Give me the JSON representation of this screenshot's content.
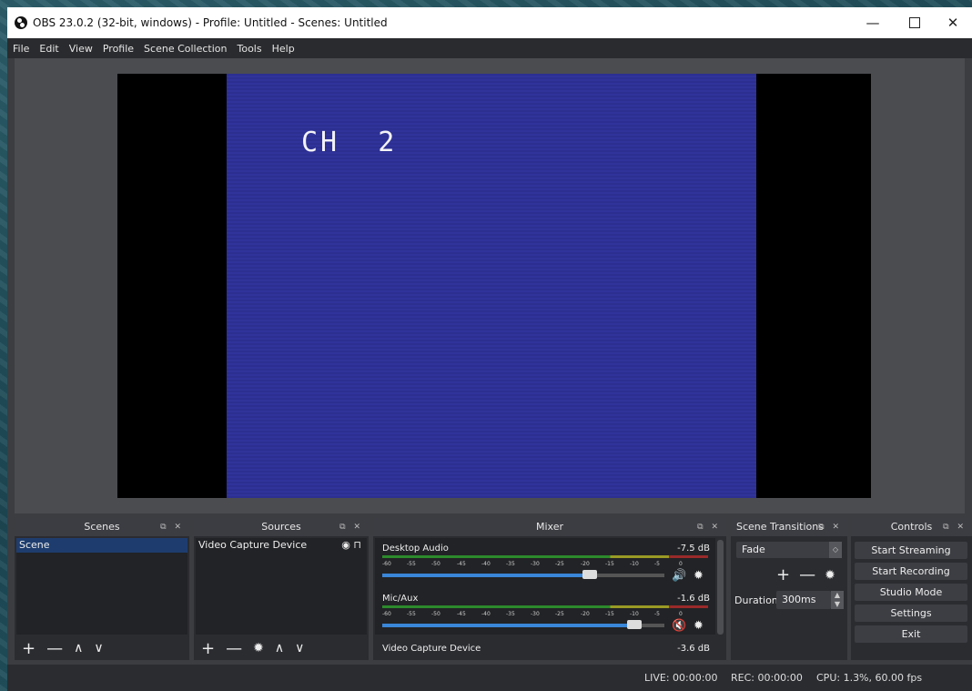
{
  "window": {
    "title": "OBS 23.0.2 (32-bit, windows) - Profile: Untitled - Scenes: Untitled",
    "minimize": "—",
    "close": "✕"
  },
  "menu": [
    "File",
    "Edit",
    "View",
    "Profile",
    "Scene Collection",
    "Tools",
    "Help"
  ],
  "preview": {
    "overlay_text": "CH  2"
  },
  "scenes": {
    "title": "Scenes",
    "items": [
      "Scene"
    ],
    "tools": {
      "add": "+",
      "remove": "—",
      "up": "∧",
      "down": "∨"
    }
  },
  "sources": {
    "title": "Sources",
    "items": [
      "Video Capture Device"
    ],
    "tools": {
      "add": "+",
      "remove": "—",
      "settings": "✹",
      "up": "∧",
      "down": "∨"
    }
  },
  "mixer": {
    "title": "Mixer",
    "ticks": [
      "-60",
      "-55",
      "-50",
      "-45",
      "-40",
      "-35",
      "-30",
      "-25",
      "-20",
      "-15",
      "-10",
      "-5",
      "0"
    ],
    "channels": [
      {
        "name": "Desktop Audio",
        "db": "-7.5 dB",
        "volume": 0.76,
        "muted": false
      },
      {
        "name": "Mic/Aux",
        "db": "-1.6 dB",
        "volume": 0.92,
        "muted": true
      },
      {
        "name": "Video Capture Device",
        "db": "-3.6 dB"
      }
    ]
  },
  "transitions": {
    "title": "Scene Transitions",
    "selected": "Fade",
    "add": "+",
    "remove": "—",
    "duration_label": "Duration",
    "duration_value": "300ms"
  },
  "controls": {
    "title": "Controls",
    "start_streaming": "Start Streaming",
    "start_recording": "Start Recording",
    "studio_mode": "Studio Mode",
    "settings": "Settings",
    "exit": "Exit"
  },
  "status": {
    "live": "LIVE: 00:00:00",
    "rec": "REC: 00:00:00",
    "cpu": "CPU: 1.3%, 60.00 fps"
  },
  "icons": {
    "dock_float": "float-icon",
    "dock_close": "close-icon",
    "visibility": "eye-icon",
    "lock": "lock-icon",
    "speaker": "speaker-icon",
    "speaker_muted": "speaker-muted-icon",
    "settings": "gear-icon"
  },
  "colors": {
    "selection": "#1e3d6e",
    "fader": "#3a86d8",
    "muted": "#e03a3a",
    "preview_blue": "#2e3194"
  }
}
